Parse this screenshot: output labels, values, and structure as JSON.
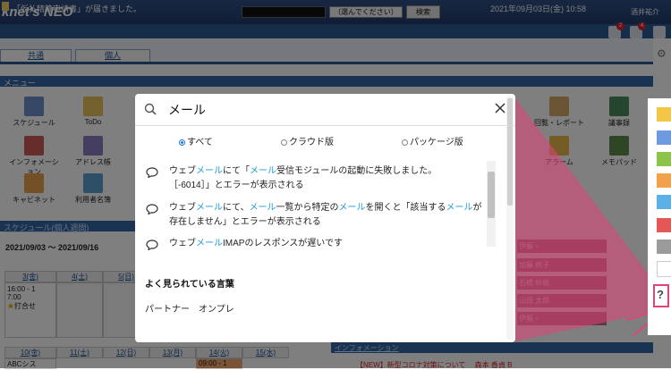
{
  "header": {
    "logo_text": "knet's NEO",
    "search_select": "（選んでください）",
    "search_button": "検索",
    "user_name": "酒井祐介"
  },
  "infobar": {
    "notice": "「仮払精算申請書」が届きました。",
    "datetime": "2021年09月03日(金) 10:58",
    "badges": [
      "2",
      "4"
    ]
  },
  "tabs": {
    "common": "共通",
    "personal": "個人"
  },
  "menu": {
    "heading": "メニュー",
    "items": [
      {
        "label": "スケジュール",
        "color": "#6a8ec8"
      },
      {
        "label": "ToDo",
        "color": "#e7c35a"
      },
      {
        "label": "インフォメーション",
        "color": "#cf5b5b"
      },
      {
        "label": "アドレス帳",
        "color": "#8b7cc0"
      },
      {
        "label": "キャビネット",
        "color": "#e6a04a"
      },
      {
        "label": "利用者名簿",
        "color": "#5aa0d0"
      },
      {
        "label": "回覧・レポート",
        "color": "#d7a868"
      },
      {
        "label": "アラーム",
        "color": "#e8b94a"
      },
      {
        "label": "議事録",
        "color": "#4c8b5c"
      },
      {
        "label": "メモパッド",
        "color": "#5c8c4a"
      }
    ]
  },
  "schedule": {
    "heading": "スケジュール(個人週間)",
    "range": "2021/09/03 ～ 2021/09/16",
    "days_row1": [
      "3(金)",
      "4(土)",
      "5(日)"
    ],
    "event_text_a": "16:00 - 1",
    "event_text_b": "7:00",
    "event_title": "打合せ",
    "days_row2": [
      "10(金)",
      "11(土)",
      "12(日)",
      "13(月)",
      "14(火)",
      "15(水)"
    ],
    "row2_event": "ABCシス",
    "row2_time": "09:00 - 1"
  },
  "names": [
    "伊藤 ○",
    "加藤 桃子",
    "石橋 紗枝",
    "山田 太郎",
    "伊藤 ○"
  ],
  "info": {
    "heading": "インフォメーション",
    "row": "【NEW】新型コロナ対策について　  森本 香貞 B"
  },
  "dialog": {
    "query": "メール",
    "filters": [
      {
        "label": "すべて",
        "selected": true
      },
      {
        "label": "クラウド版",
        "selected": false
      },
      {
        "label": "パッケージ版",
        "selected": false
      }
    ],
    "results": [
      {
        "line1": [
          [
            "ウェブ",
            false
          ],
          [
            "メール",
            true
          ],
          [
            "にて「",
            false
          ],
          [
            "メール",
            true
          ],
          [
            "受信モジュールの起動に失敗しました。",
            false
          ]
        ],
        "line2": [
          [
            "［-6014］」とエラーが表示される",
            false
          ]
        ]
      },
      {
        "line1": [
          [
            "ウェブ",
            false
          ],
          [
            "メール",
            true
          ],
          [
            "にて、",
            false
          ],
          [
            "メール",
            true
          ],
          [
            "一覧から特定の",
            false
          ],
          [
            "メール",
            true
          ],
          [
            "を開くと「該当する",
            false
          ],
          [
            "メール",
            true
          ],
          [
            "が",
            false
          ]
        ],
        "line2": [
          [
            "存在しません」とエラーが表示される",
            false
          ]
        ]
      },
      {
        "line1": [
          [
            "ウェブ",
            false
          ],
          [
            "メール",
            true
          ],
          [
            "IMAPのレスポンスが遅いです",
            false
          ]
        ],
        "line2": []
      }
    ],
    "faq_title": "よく見られている言葉",
    "faq_links": "パートナー　オンプレ"
  },
  "tool_colors": [
    "#f2c744",
    "#6c9be0",
    "#8cc34a",
    "#f1a04c",
    "#5db0e6",
    "#e55656",
    "#9b9b9b"
  ],
  "accent_color": "#1a9ad6",
  "highlight_color": "#e0447a"
}
